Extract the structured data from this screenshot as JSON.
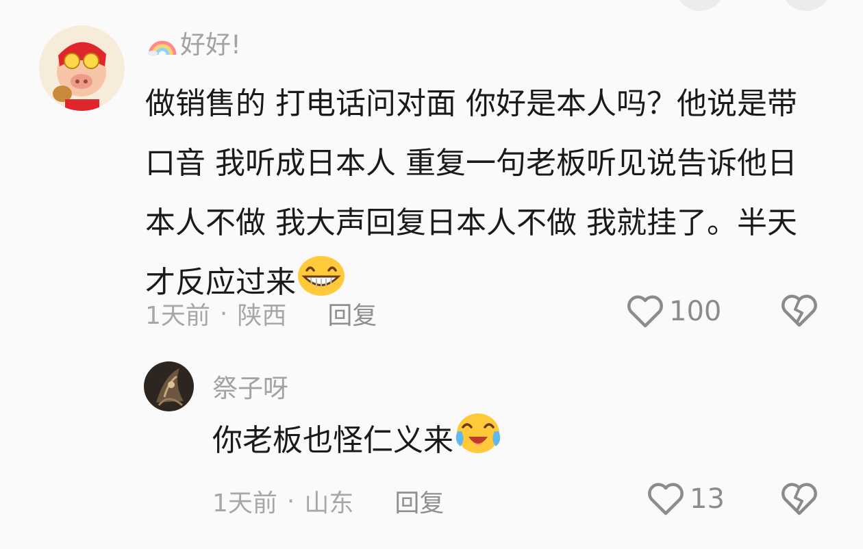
{
  "comments": [
    {
      "username": "好好!",
      "text": "做销售的 打电话问对面 你好是本人吗？他说是带口音 我听成日本人 重复一句老板听见说告诉他日本人不做 我大声回复日本人不做 我就挂了。半天才反应过来",
      "emoji": "grin-emoji",
      "time": "1天前",
      "separator": "·",
      "location": "陕西",
      "reply_label": "回复",
      "likes": "100"
    },
    {
      "username": "祭子呀",
      "text": "你老板也怪仁义来",
      "emoji": "tears-of-joy-emoji",
      "time": "1天前",
      "separator": "·",
      "location": "山东",
      "reply_label": "回复",
      "likes": "13"
    }
  ]
}
